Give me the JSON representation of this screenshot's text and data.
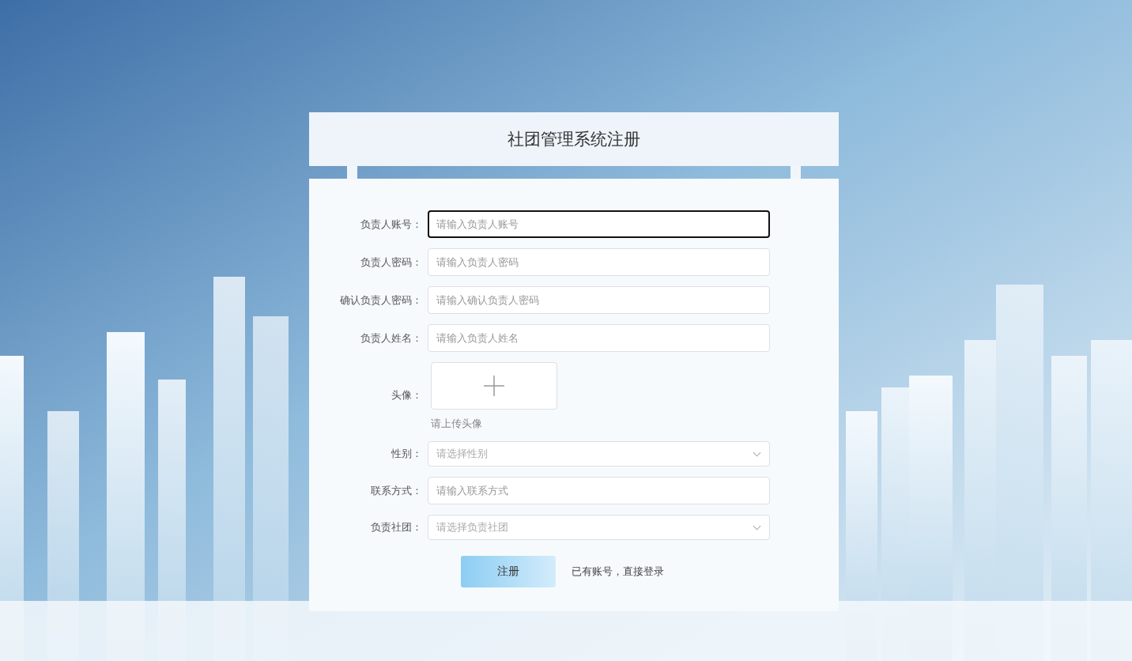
{
  "title": "社团管理系统注册",
  "fields": [
    {
      "kind": "input",
      "label": "负责人账号：",
      "placeholder": "请输入负责人账号",
      "focused": true
    },
    {
      "kind": "input",
      "label": "负责人密码：",
      "placeholder": "请输入负责人密码",
      "focused": false
    },
    {
      "kind": "input",
      "label": "确认负责人密码：",
      "placeholder": "请输入确认负责人密码",
      "focused": false
    },
    {
      "kind": "input",
      "label": "负责人姓名：",
      "placeholder": "请输入负责人姓名",
      "focused": false
    },
    {
      "kind": "upload",
      "label": "头像：",
      "hint": "请上传头像"
    },
    {
      "kind": "select",
      "label": "性别：",
      "placeholder": "请选择性别"
    },
    {
      "kind": "input",
      "label": "联系方式：",
      "placeholder": "请输入联系方式",
      "focused": false
    },
    {
      "kind": "select",
      "label": "负责社团：",
      "placeholder": "请选择负责社团"
    }
  ],
  "submit_button": "注册",
  "login_link": "已有账号，直接登录"
}
